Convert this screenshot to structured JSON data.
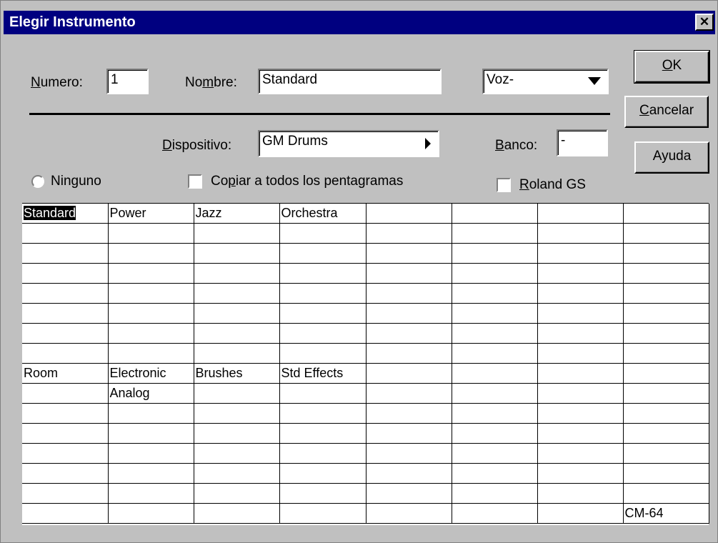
{
  "window": {
    "title": "Elegir Instrumento",
    "close_glyph": "✕"
  },
  "fields": {
    "numero_label_pre": "",
    "numero_label_u": "N",
    "numero_label_post": "umero:",
    "numero_value": "1",
    "nombre_label_pre": "No",
    "nombre_label_u": "m",
    "nombre_label_post": "bre:",
    "nombre_value": "Standard",
    "voz_value": "Voz-",
    "dispositivo_label_pre": "",
    "dispositivo_label_u": "D",
    "dispositivo_label_post": "ispositivo:",
    "dispositivo_value": "GM Drums",
    "banco_label_pre": "",
    "banco_label_u": "B",
    "banco_label_post": "anco:",
    "banco_value": "-"
  },
  "options": {
    "ninguno_pre": "Nin",
    "ninguno_u": "g",
    "ninguno_post": "uno",
    "copiar_pre": "Co",
    "copiar_u": "p",
    "copiar_post": "iar a todos los pentagramas",
    "roland_pre": "",
    "roland_u": "R",
    "roland_post": "oland GS"
  },
  "buttons": {
    "ok_u": "O",
    "ok_post": "K",
    "cancel_u": "C",
    "cancel_post": "ancelar",
    "help": "Ayuda"
  },
  "grid": {
    "row0": [
      "Standard",
      "Power",
      "Jazz",
      "Orchestra",
      "",
      "",
      "",
      ""
    ],
    "row8a": [
      "Room",
      "Electronic",
      "Brushes",
      "Std Effects",
      "",
      "",
      "",
      ""
    ],
    "row8b": [
      "",
      "Analog",
      "",
      "",
      "",
      "",
      "",
      ""
    ],
    "row15_last": "CM-64"
  }
}
